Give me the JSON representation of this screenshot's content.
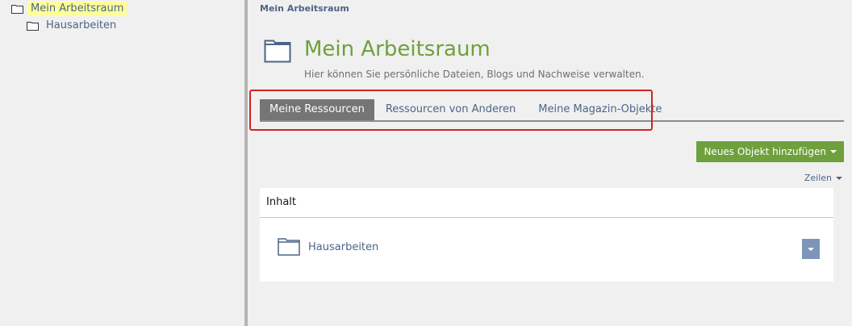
{
  "tree": {
    "items": [
      {
        "label": "Mein Arbeitsraum",
        "active": true
      },
      {
        "label": "Hausarbeiten",
        "active": false
      }
    ]
  },
  "breadcrumb": "Mein Arbeitsraum",
  "header": {
    "title": "Mein Arbeitsraum",
    "description": "Hier können Sie persönliche Dateien, Blogs und Nachweise verwalten."
  },
  "tabs": [
    {
      "label": "Meine Ressourcen",
      "active": true
    },
    {
      "label": "Ressourcen von Anderen",
      "active": false
    },
    {
      "label": "Meine Magazin-Objekte",
      "active": false
    }
  ],
  "actions": {
    "add_object_label": "Neues Objekt hinzufügen",
    "rows_label": "Zeilen"
  },
  "content": {
    "heading": "Inhalt",
    "items": [
      {
        "label": "Hausarbeiten"
      }
    ]
  },
  "colors": {
    "accent_green": "#6ea03c",
    "link_blue": "#4c6586",
    "highlight_yellow": "#ffff9a",
    "annotation_red": "#d3231e"
  },
  "icons": {
    "tree_node": "folder-icon",
    "header": "folder-icon",
    "item": "folder-icon",
    "item_actions": "chevron-down-icon"
  }
}
